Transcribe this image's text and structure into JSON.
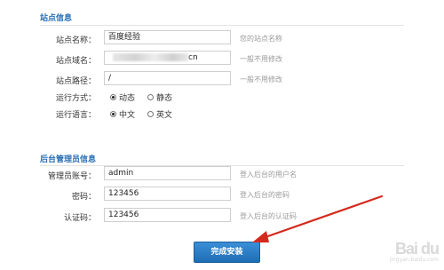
{
  "site_section": {
    "title": "站点信息",
    "rows": [
      {
        "label": "站点名称：",
        "value": "百度经验",
        "hint": "您的站点名称"
      },
      {
        "label": "站点域名：",
        "value": "cn",
        "hint": "一般不用修改"
      },
      {
        "label": "站点路径：",
        "value": "/",
        "hint": "一般不用修改"
      }
    ],
    "run_mode": {
      "label": "运行方式：",
      "options": [
        "动态",
        "静态"
      ],
      "selected": "动态"
    },
    "language": {
      "label": "运行语言：",
      "options": [
        "中文",
        "英文"
      ],
      "selected": "中文"
    }
  },
  "admin_section": {
    "title": "后台管理员信息",
    "rows": [
      {
        "label": "管理员账号：",
        "value": "admin",
        "hint": "登入后台的用户名"
      },
      {
        "label": "密码：",
        "value": "123456",
        "hint": "登入后台的密码"
      },
      {
        "label": "认证码：",
        "value": "123456",
        "hint": "登入后台的认证码"
      }
    ]
  },
  "submit_label": "完成安装",
  "colors": {
    "section_title": "#2a6fb5",
    "button": "#1e6eb6",
    "arrow": "#d42a1e"
  },
  "watermark": {
    "logo": "Bai du",
    "sub": "jingyan.baidu.com"
  }
}
